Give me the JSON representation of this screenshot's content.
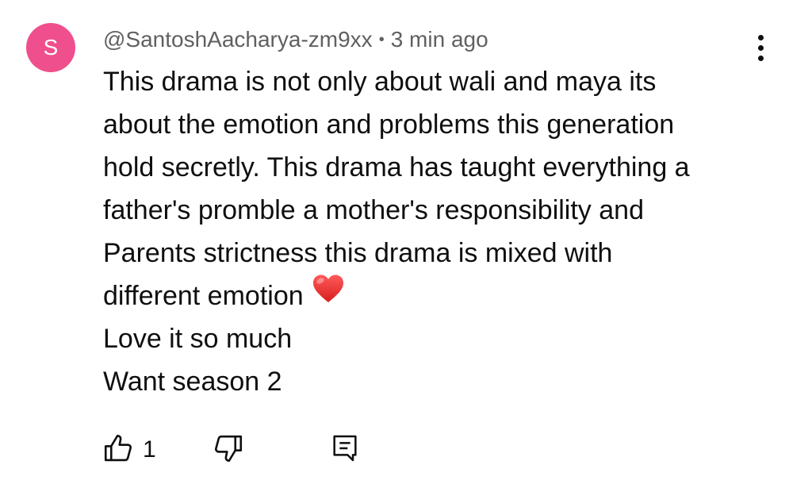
{
  "comment": {
    "avatar_letter": "S",
    "avatar_color": "#ef4f8c",
    "author": "@SantoshAacharya-zm9xx",
    "separator": "•",
    "timestamp": "3 min ago",
    "text_lines": [
      "This drama is not only about wali and maya its",
      "about the emotion and problems this generation",
      "hold secretly. This drama has taught everything a",
      "father's promble a mother's responsibility and",
      "Parents strictness this drama is mixed with",
      "different emotion",
      "Love it so much",
      "Want season 2"
    ],
    "emoji": "red-heart",
    "like_count": "1"
  },
  "icons": {
    "more": "more-vert-icon",
    "like": "thumbs-up-icon",
    "dislike": "thumbs-down-icon",
    "reply": "comment-reply-icon"
  }
}
